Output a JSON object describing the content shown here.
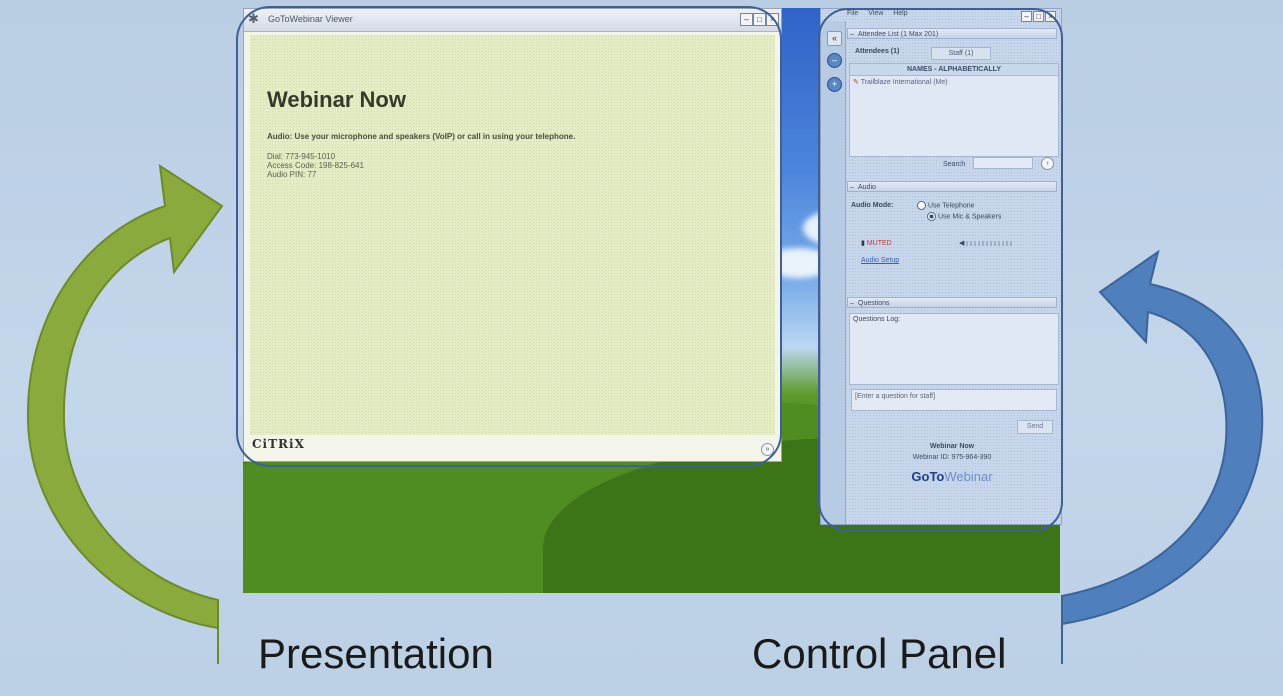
{
  "viewer": {
    "title": "GoToWebinar Viewer",
    "slide": {
      "heading": "Webinar Now",
      "audio_line": "Audio: Use your microphone and speakers (VoIP) or call in using your telephone.",
      "dial": "Dial: 773-945-1010",
      "access_code": "Access Code: 198-825-641",
      "audio_pin": "Audio PIN: 77"
    },
    "logo": "CiTRiX"
  },
  "control_panel": {
    "menu": [
      "File",
      "View",
      "Help"
    ],
    "attendee_list_header": "Attendee List (1 Max 201)",
    "attendees_tab": "Attendees (1)",
    "staff_tab": "Staff (1)",
    "column_header": "NAMES - ALPHABETICALLY",
    "attendee_name": "Trailblaze International (Me)",
    "search_label": "Search",
    "audio_header": "Audio",
    "audio_mode_label": "Audio Mode:",
    "audio_options": [
      "Use Telephone",
      "Use Mic & Speakers"
    ],
    "muted_label": "MUTED",
    "audio_setup_link": "Audio Setup",
    "questions_header": "Questions",
    "questions_log_label": "Questions Log:",
    "question_placeholder": "[Enter a question for staff]",
    "send_label": "Send",
    "footer_title": "Webinar Now",
    "webinar_id": "Webinar ID: 975-964-390",
    "brand_bold": "GoTo",
    "brand_light": "Webinar"
  },
  "captions": {
    "left": "Presentation",
    "right": "Control Panel"
  },
  "colors": {
    "background": "#c4d6ea",
    "left_arrow": "#8aaa3e",
    "right_arrow": "#4f7fbd",
    "outline": "#3f5f95"
  }
}
